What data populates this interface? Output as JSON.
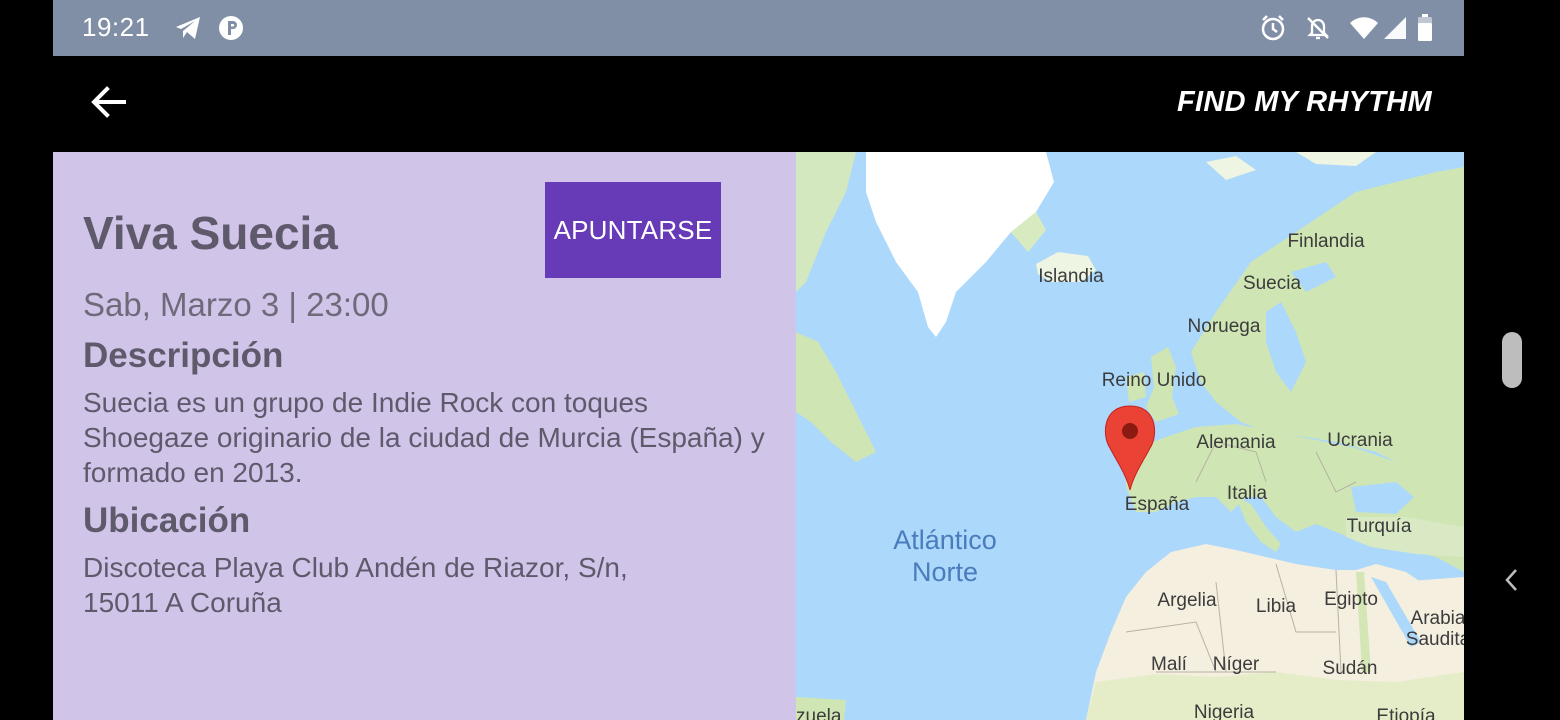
{
  "status_bar": {
    "time": "19:21",
    "left_icons": [
      "telegram-icon",
      "p-icon"
    ],
    "right_icons": [
      "alarm-icon",
      "notifications-off-icon",
      "wifi-icon",
      "signal-icon",
      "battery-icon"
    ]
  },
  "app_bar": {
    "back_icon": "arrow-left-icon",
    "title": "FIND MY RHYTHM"
  },
  "event": {
    "title": "Viva Suecia",
    "signup_label": "APUNTARSE",
    "date": "Sab, Marzo 3 | 23:00",
    "description_heading": "Descripción",
    "description_text": "Suecia es un grupo de Indie Rock con toques Shoegaze originario de la ciudad de Murcia (España) y formado en 2013.",
    "location_heading": "Ubicación",
    "location_text": "Discoteca Playa Club Andén de Riazor, S/n, 15011 A Coruña"
  },
  "map": {
    "marker_icon": "map-pin-icon",
    "labels": {
      "islandia": "Islandia",
      "finlandia": "Finlandia",
      "suecia": "Suecia",
      "noruega": "Noruega",
      "reino_unido": "Reino Unido",
      "alemania": "Alemania",
      "ucrania": "Ucrania",
      "italia": "Italia",
      "espana": "España",
      "turquia": "Turquía",
      "atlantico_1": "Atlántico",
      "atlantico_2": "Norte",
      "argelia": "Argelia",
      "libia": "Libia",
      "egipto": "Egipto",
      "arabia_1": "Arabia",
      "arabia_2": "Saudita",
      "mali": "Malí",
      "niger": "Níger",
      "sudan": "Sudán",
      "nigeria": "Nigeria",
      "etiopia": "Etiopía",
      "venezuela": "zuela"
    },
    "colors": {
      "water": "#abd8fb",
      "land_green": "#cfe6b4",
      "land_desert": "#f5efe0",
      "ice": "#ffffff",
      "marker": "#ea4335"
    }
  },
  "colors": {
    "status_bar": "#808fa6",
    "app_bar": "#000000",
    "details_bg": "#d1c4e9",
    "button": "#673ab7",
    "text": "#5f5a6b"
  }
}
